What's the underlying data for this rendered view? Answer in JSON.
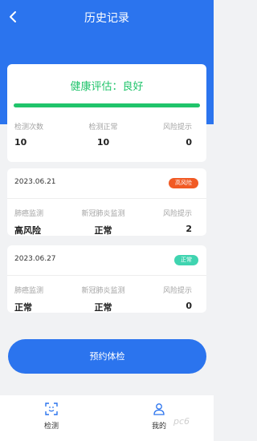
{
  "header": {
    "title": "历史记录",
    "back_icon": "chevron-left-icon"
  },
  "summary": {
    "title": "健康评估：良好",
    "progress": 1.0,
    "stats": [
      {
        "label": "检测次数",
        "value": "10"
      },
      {
        "label": "检测正常",
        "value": "10"
      },
      {
        "label": "风险提示",
        "value": "0"
      }
    ]
  },
  "records": [
    {
      "date": "2023.06.21",
      "badge": "高风险",
      "badge_color": "#f15a24",
      "stats": [
        {
          "label": "肺癌监测",
          "value": "高风险"
        },
        {
          "label": "新冠肺炎监测",
          "value": "正常"
        },
        {
          "label": "风险提示",
          "value": "2"
        }
      ]
    },
    {
      "date": "2023.06.27",
      "badge": "正常",
      "badge_color": "#3fd4b0",
      "stats": [
        {
          "label": "肺癌监测",
          "value": "正常"
        },
        {
          "label": "新冠肺炎监测",
          "value": "正常"
        },
        {
          "label": "风险提示",
          "value": "0"
        }
      ]
    }
  ],
  "book_button": "预约体检",
  "tabbar": {
    "items": [
      {
        "label": "检测",
        "icon": "scan-icon",
        "active": true
      },
      {
        "label": "我的",
        "icon": "user-icon",
        "active": false
      }
    ]
  },
  "colors": {
    "primary": "#2b74ee",
    "good": "#20c46b"
  },
  "watermark": "pc6"
}
